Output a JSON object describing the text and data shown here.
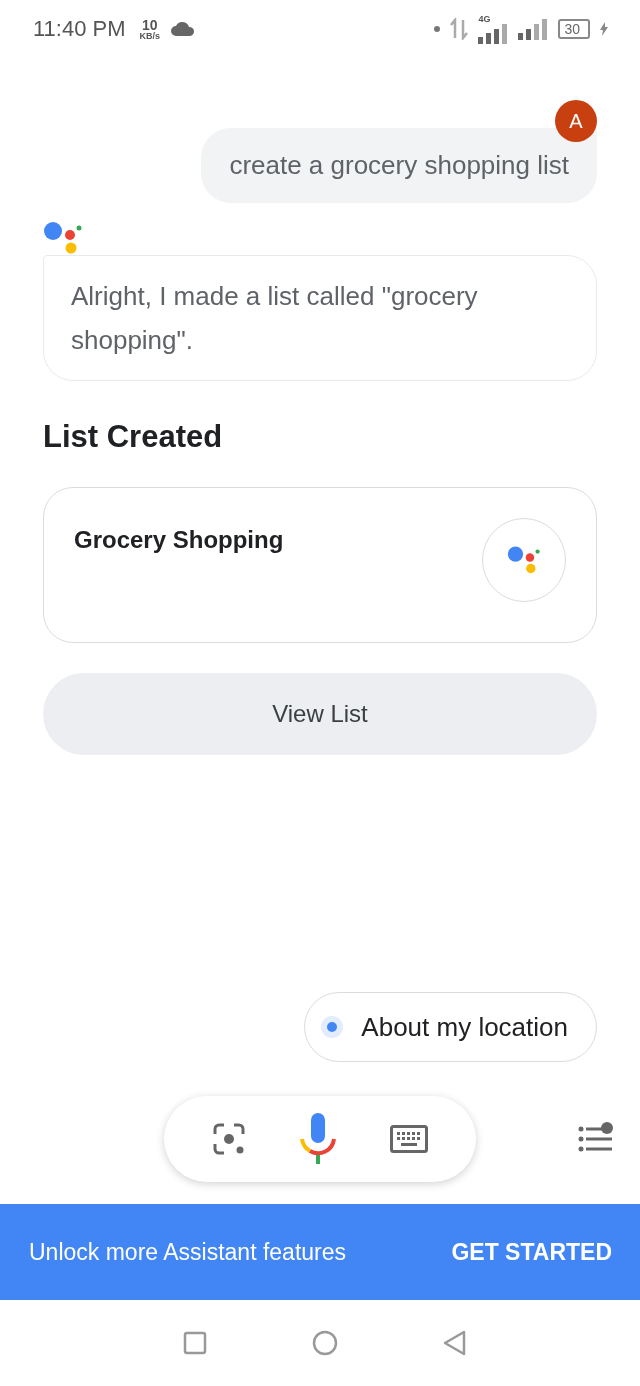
{
  "status_bar": {
    "time": "11:40 PM",
    "speed_value": "10",
    "speed_unit": "KB/s",
    "network": "4G",
    "battery": "30"
  },
  "user_message": {
    "avatar_letter": "A",
    "text": "create a grocery shopping list"
  },
  "assistant_message": {
    "text": "Alright, I made a list called \"grocery shopping\"."
  },
  "list_heading": "List Created",
  "list_card": {
    "title": "Grocery Shopping"
  },
  "view_button": "View List",
  "suggestion_chip": "About my location",
  "banner": {
    "text": "Unlock more Assistant features",
    "action": "GET STARTED"
  }
}
